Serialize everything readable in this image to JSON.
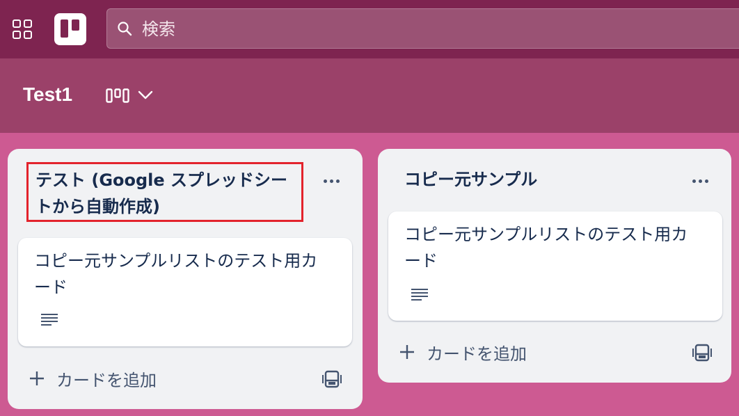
{
  "header": {
    "search_placeholder": "検索",
    "icons": {
      "apps": "grid-apps-icon",
      "logo": "trello-logo",
      "search": "search-icon"
    }
  },
  "board": {
    "title": "Test1",
    "icons": {
      "view": "board-columns-icon",
      "dropdown": "chevron-down-icon"
    }
  },
  "lists": [
    {
      "title": "テスト (Google スプレッドシートから自動作成)",
      "highlighted": true,
      "cards": [
        {
          "text": "コピー元サンプルリストのテスト用カード",
          "has_description": true
        }
      ],
      "add_card_label": "カードを追加"
    },
    {
      "title": "コピー元サンプル",
      "highlighted": false,
      "cards": [
        {
          "text": "コピー元サンプルリストのテスト用カード",
          "has_description": true
        }
      ],
      "add_card_label": "カードを追加"
    }
  ],
  "colors": {
    "topbar": "#7e2450",
    "boardbar": "#9b4169",
    "background": "#cd5a92",
    "list_bg": "#f1f2f4",
    "highlight_border": "#e3232c"
  }
}
